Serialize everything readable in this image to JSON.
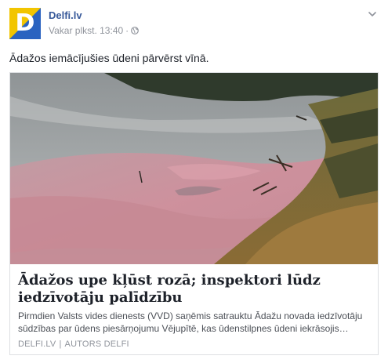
{
  "page": {
    "name": "Delfi.lv",
    "avatar_letter": "D",
    "brand_colors": {
      "blue": "#2a63c0",
      "yellow": "#f2c500"
    }
  },
  "meta": {
    "timestamp": "Vakar plkst. 13:40",
    "separator": "·",
    "privacy_icon": "globe-icon"
  },
  "menu_icon": "chevron-down-icon",
  "post": {
    "text": "Ādažos iemācījušies ūdeni pārvērst vīnā."
  },
  "link": {
    "image_icon": "photo-pink-river",
    "title": "Ādažos upe kļūst rozā; inspektori lūdz iedzīvotāju palīdzību",
    "description": "Pirmdien Valsts vides dienests (VVD) saņēmis satrauktu Ādažu novada iedzīvotāju sūdzības par ūdens piesārņojumu Vējupītē, kas ūdenstilpnes ūdeni iekrāsojis…",
    "source": "DELFI.LV",
    "source_sep": "|",
    "author": "AUTORS DELFI"
  }
}
